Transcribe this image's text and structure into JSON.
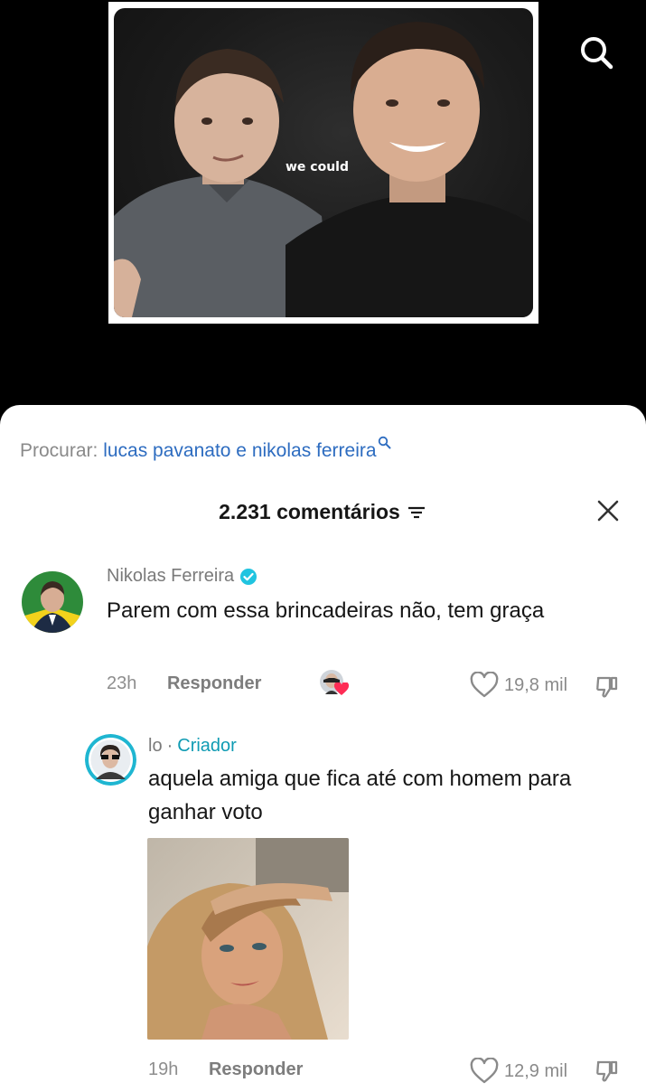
{
  "video": {
    "caption": "we could"
  },
  "search_suggestion": {
    "label": "Procurar:",
    "query": "lucas pavanato e nikolas ferreira"
  },
  "comments_header": {
    "count_text": "2.231 comentários"
  },
  "comments": [
    {
      "author": "Nikolas Ferreira",
      "verified": true,
      "text": "Parem com essa brincadeiras não, tem graça",
      "time": "23h",
      "reply_label": "Responder",
      "liked_by_creator": true,
      "likes": "19,8 mil"
    },
    {
      "author": "lo",
      "separator": "·",
      "badge": "Criador",
      "text": "aquela amiga que fica até com homem para ganhar voto",
      "has_image": true,
      "time": "19h",
      "reply_label": "Responder",
      "likes": "12,9 mil"
    }
  ],
  "colors": {
    "background": "#000000",
    "sheet": "#ffffff",
    "link": "#2d6cc0",
    "creator_badge": "#0f9bb3",
    "verified": "#20c4e0",
    "heart_accent": "#fe2c55"
  },
  "icons": [
    "search-icon",
    "sort-icon",
    "close-icon",
    "verified-icon",
    "heart-icon",
    "dislike-icon"
  ]
}
